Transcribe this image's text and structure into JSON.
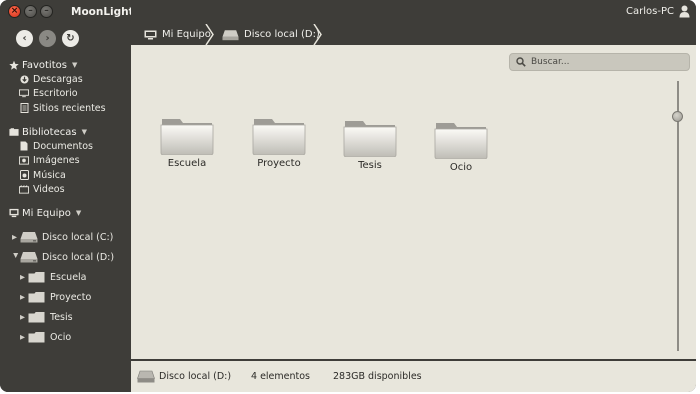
{
  "app": {
    "title": "MoonLight",
    "user": "Carlos-PC"
  },
  "window_controls": {
    "close": "×",
    "minimize": "–",
    "maximize": "–"
  },
  "nav": {
    "back": "‹",
    "forward": "›",
    "refresh": "↻"
  },
  "sidebar": {
    "favorites": {
      "title": "Favotitos",
      "items": [
        {
          "label": "Descargas",
          "icon": "download-icon"
        },
        {
          "label": "Escritorio",
          "icon": "desktop-icon"
        },
        {
          "label": "Sitios recientes",
          "icon": "recent-sites-icon"
        }
      ]
    },
    "libraries": {
      "title": "Bibliotecas",
      "items": [
        {
          "label": "Documentos",
          "icon": "document-icon"
        },
        {
          "label": "Imágenes",
          "icon": "image-icon"
        },
        {
          "label": "Música",
          "icon": "music-icon"
        },
        {
          "label": "Videos",
          "icon": "video-icon"
        }
      ]
    },
    "computer": {
      "title": "Mi Equipo",
      "drives": [
        {
          "label": "Disco local (C:)"
        },
        {
          "label": "Disco local (D:)"
        }
      ],
      "folders": [
        {
          "label": "Escuela"
        },
        {
          "label": "Proyecto"
        },
        {
          "label": "Tesis"
        },
        {
          "label": "Ocio"
        }
      ]
    }
  },
  "breadcrumb": [
    {
      "label": "Mi Equipo"
    },
    {
      "label": "Disco local (D:)"
    }
  ],
  "search": {
    "placeholder": "Buscar..."
  },
  "folders": [
    {
      "label": "Escuela"
    },
    {
      "label": "Proyecto"
    },
    {
      "label": "Tesis"
    },
    {
      "label": "Ocio"
    }
  ],
  "status": {
    "location": "Disco local (D:)",
    "count": "4 elementos",
    "free": "283GB disponibles"
  },
  "colors": {
    "chrome": "#3e3d39",
    "content": "#e8e6dc",
    "close_button": "#e0341a"
  }
}
